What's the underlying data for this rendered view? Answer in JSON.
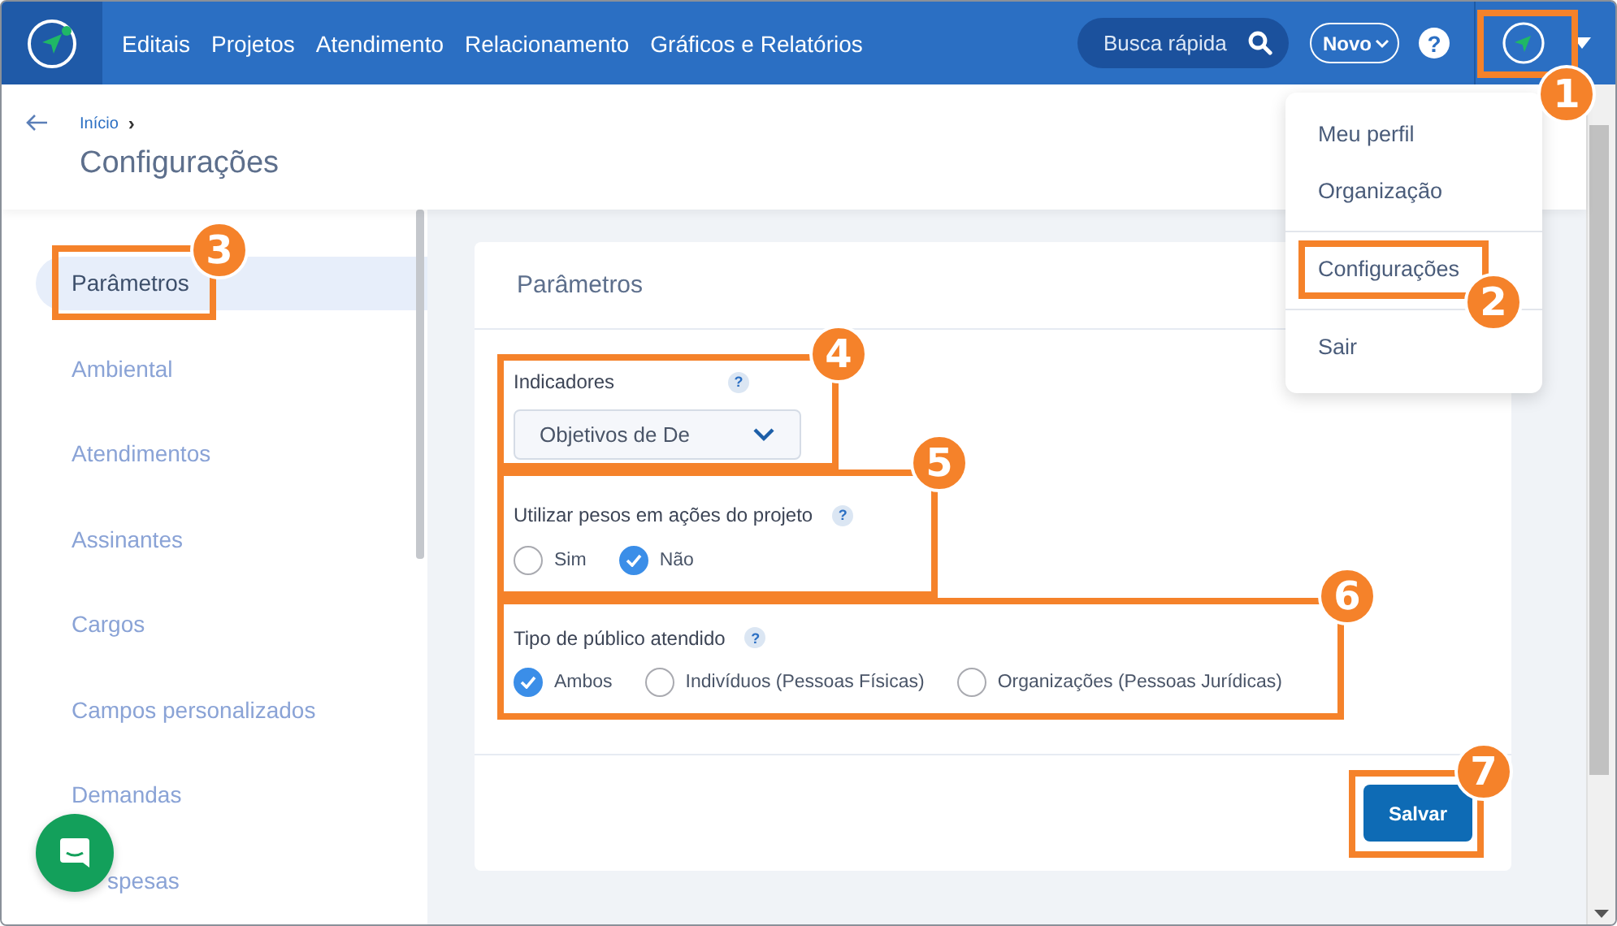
{
  "topbar": {
    "nav": [
      "Editais",
      "Projetos",
      "Atendimento",
      "Relacionamento",
      "Gráficos e Relatórios"
    ],
    "search": {
      "placeholder": "Busca rápida"
    },
    "new_button": "Novo",
    "help": "?"
  },
  "user_menu": {
    "groups": [
      [
        "Meu perfil",
        "Organização"
      ],
      [
        "Configurações"
      ],
      [
        "Sair"
      ]
    ]
  },
  "breadcrumb": {
    "link": "Início",
    "separator": "›"
  },
  "page_title": "Configurações",
  "sidebar": {
    "items": [
      {
        "label": "Parâmetros",
        "selected": true
      },
      {
        "label": "Ambiental",
        "selected": false
      },
      {
        "label": "Atendimentos",
        "selected": false
      },
      {
        "label": "Assinantes",
        "selected": false
      },
      {
        "label": "Cargos",
        "selected": false
      },
      {
        "label": "Campos personalizados",
        "selected": false
      },
      {
        "label": "Demandas",
        "selected": false
      },
      {
        "label": "spesas",
        "selected": false
      }
    ]
  },
  "card": {
    "title": "Parâmetros",
    "fields": [
      {
        "kind": "select",
        "label": "Indicadores",
        "help": "?",
        "value": "Objetivos de De"
      },
      {
        "kind": "radio",
        "label": "Utilizar pesos em ações do projeto",
        "help": "?",
        "options": [
          {
            "label": "Sim",
            "selected": false
          },
          {
            "label": "Não",
            "selected": true
          }
        ]
      },
      {
        "kind": "radio",
        "label": "Tipo de público atendido",
        "help": "?",
        "options": [
          {
            "label": "Ambos",
            "selected": true
          },
          {
            "label": "Indivíduos (Pessoas Físicas)",
            "selected": false
          },
          {
            "label": "Organizações (Pessoas Jurídicas)",
            "selected": false
          }
        ]
      }
    ],
    "save_button": "Salvar"
  },
  "annotations": [
    "1",
    "2",
    "3",
    "4",
    "5",
    "6",
    "7"
  ]
}
